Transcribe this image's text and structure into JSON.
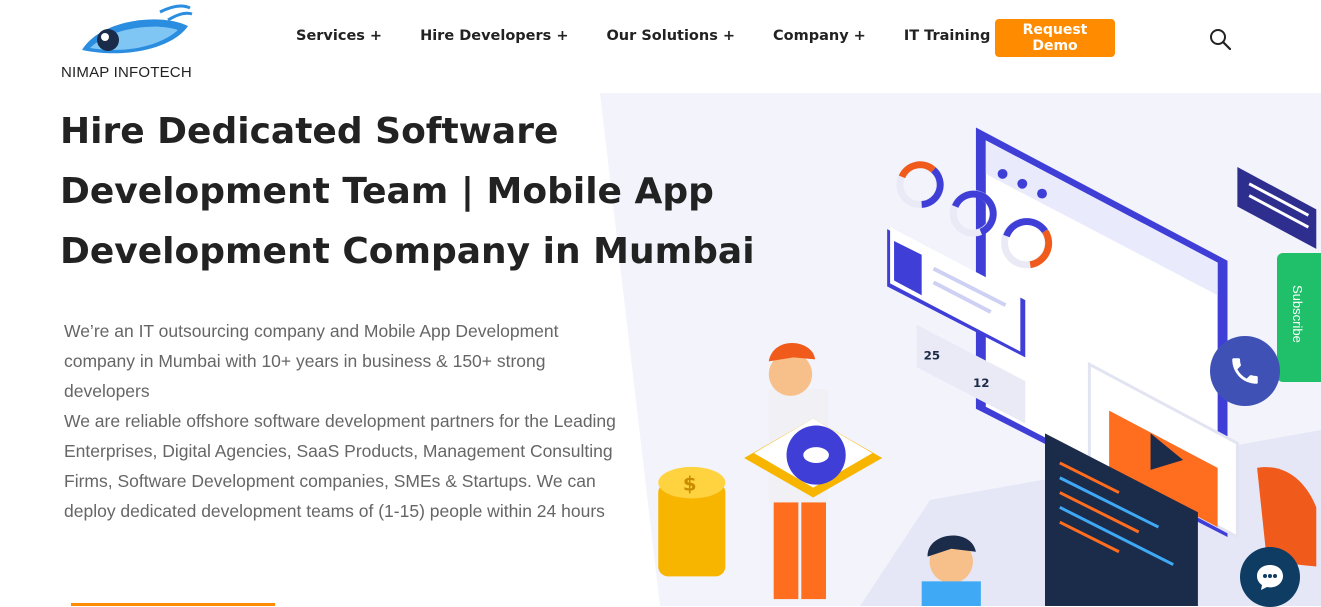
{
  "brand": {
    "name": "NIMAP INFOTECH",
    "logo_icon": "eye-logo-icon"
  },
  "nav": {
    "items": [
      {
        "label": "Services",
        "suffix": "+"
      },
      {
        "label": "Hire Developers",
        "suffix": "+"
      },
      {
        "label": "Our Solutions",
        "suffix": "+"
      },
      {
        "label": "Company",
        "suffix": "+"
      },
      {
        "label": "IT Training",
        "suffix": "+"
      }
    ],
    "demo_label": "Request Demo",
    "search_icon": "search-icon"
  },
  "hero": {
    "title": "Hire Dedicated Software Development Team | Mobile App Development Company in Mumbai",
    "paragraph1": "We’re an IT outsourcing company and Mobile App Development company in Mumbai with 10+ years in business & 150+ strong developers",
    "paragraph2": "We are reliable offshore software development partners for the Leading Enterprises, Digital Agencies, SaaS Products, Management Consulting Firms, Software Development companies, SMEs & Startups. We can deploy dedicated development teams of (1-15) people within 24 hours"
  },
  "illustration": {
    "likes": "25",
    "comments": "12"
  },
  "widgets": {
    "subscribe_label": "Subscribe",
    "phone_icon": "phone-icon",
    "chat_icon": "chat-icon"
  },
  "colors": {
    "accent": "#ff8c00",
    "primary": "#3f3fd8",
    "success": "#20c06a",
    "chat": "#0e3c63"
  }
}
